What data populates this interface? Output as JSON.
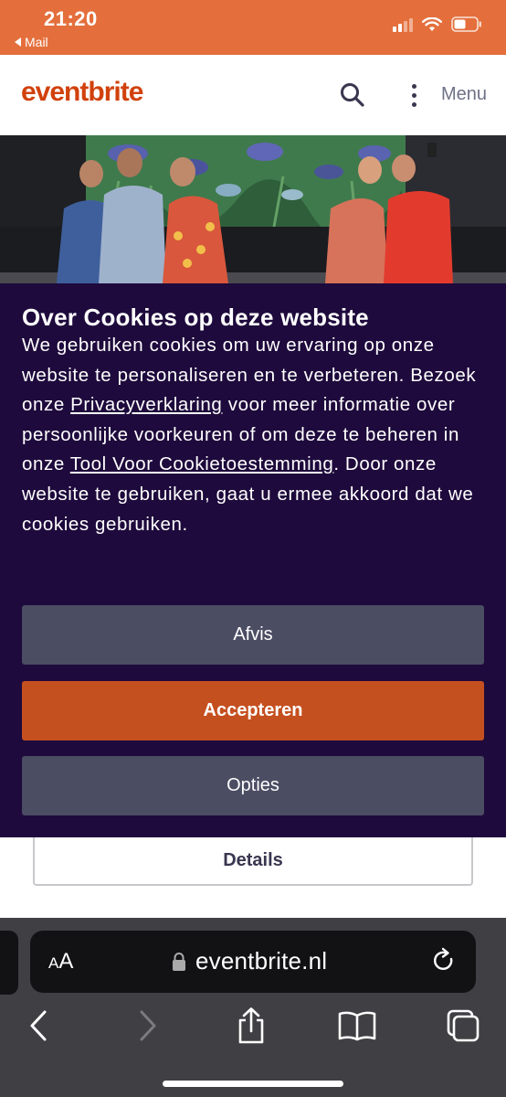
{
  "statusbar": {
    "time": "21:20",
    "back_app": "Mail",
    "icons": [
      "signal-icon",
      "wifi-icon",
      "battery-icon"
    ]
  },
  "header": {
    "logo": "eventbrite",
    "menu_label": "Menu",
    "icons": [
      "search-icon",
      "more-vertical-icon"
    ]
  },
  "cookie_banner": {
    "title": "Over Cookies op deze website",
    "text_1": "We gebruiken cookies om uw ervaring op onze website te personaliseren en te verbeteren. Bezoek onze ",
    "link_privacy": "Privacyverklaring",
    "text_2": " voor meer informatie over persoonlijke voorkeuren of om deze te beheren in onze ",
    "link_tool": "Tool Voor Cookietoestemming",
    "text_3": ". Door onze website te gebruiken, gaat u ermee akkoord dat we cookies gebruiken.",
    "reject_label": "Afvis",
    "accept_label": "Accepteren",
    "options_label": "Opties"
  },
  "details_label": "Details",
  "safari": {
    "text_size_small": "A",
    "text_size_large": "A",
    "url": "eventbrite.nl",
    "icons": [
      "lock-icon",
      "reload-icon",
      "back-icon",
      "forward-icon",
      "share-icon",
      "bookmarks-icon",
      "tabs-icon"
    ]
  },
  "colors": {
    "status_bar": "#e46f3c",
    "brand": "#d1410c",
    "banner_bg": "#1e0a3c",
    "accept_bg": "#c5501f",
    "secondary_btn_bg": "#4b4d63",
    "safari_bg": "#404044"
  }
}
